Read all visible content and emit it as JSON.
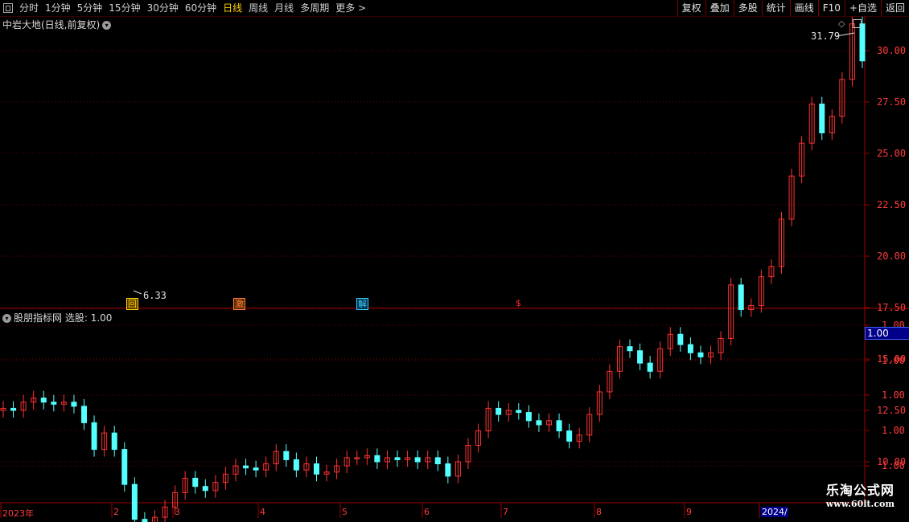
{
  "toolbar": {
    "periods": [
      "分时",
      "1分钟",
      "5分钟",
      "15分钟",
      "30分钟",
      "60分钟",
      "日线",
      "周线",
      "月线",
      "多周期",
      "更多 >"
    ],
    "active_period": "日线",
    "right_buttons": [
      "复权",
      "叠加",
      "多股",
      "统计",
      "画线",
      "F10",
      "+自选",
      "返回"
    ]
  },
  "main_panel": {
    "title": "中岩大地(日线,前复权)",
    "dropdown_icon": "chevron-down-icon",
    "max_label": "31.79",
    "min_label": "6.33",
    "price_axis": [
      "30.00",
      "27.50",
      "25.00",
      "22.50",
      "20.00",
      "17.50",
      "15.00",
      "12.50",
      "10.00"
    ],
    "markers": [
      {
        "text": "回",
        "color": "#ffd400",
        "bg": "#5a3a00"
      },
      {
        "text": "激",
        "color": "#ff8040",
        "bg": "#5a2a00"
      },
      {
        "text": "解",
        "color": "#40d0ff",
        "bg": "#00304a"
      },
      {
        "text": "$",
        "color": "#ff3030",
        "bg": "transparent"
      }
    ]
  },
  "indicator_panel": {
    "title": "股朋指标网",
    "value_label": "选股: 1.00",
    "axis": [
      "1.00",
      "1.00",
      "1.00",
      "1.00",
      "1.00"
    ],
    "current_value": "1.00"
  },
  "date_axis": [
    "2023年",
    "2",
    "3",
    "4",
    "5",
    "6",
    "7",
    "8",
    "9",
    "2024/"
  ],
  "watermark": {
    "line1": "乐淘公式网",
    "line2": "www.60lt.com"
  },
  "colors": {
    "up": "#ff3232",
    "down": "#54ffff",
    "grid": "#7a0000",
    "axis_text": "#ff3b3b"
  },
  "chart_data": {
    "type": "candlestick",
    "title": "中岩大地(日线,前复权)",
    "y_axis_ticks": [
      10.0,
      12.5,
      15.0,
      17.5,
      20.0,
      22.5,
      25.0,
      27.5,
      30.0
    ],
    "x_month_labels": [
      "2023年",
      "2",
      "3",
      "4",
      "5",
      "6",
      "7",
      "8",
      "9",
      "2024/"
    ],
    "annotated_high": 31.79,
    "annotated_low": 6.33,
    "series": [
      {
        "name": "close",
        "values": [
          12.6,
          12.5,
          12.9,
          13.1,
          12.9,
          12.8,
          12.9,
          12.7,
          11.9,
          10.6,
          11.4,
          10.6,
          8.9,
          7.2,
          6.4,
          7.3,
          7.8,
          8.5,
          9.2,
          8.8,
          8.6,
          9.0,
          9.4,
          9.8,
          9.7,
          9.6,
          9.9,
          10.5,
          10.1,
          9.6,
          9.9,
          9.4,
          9.5,
          9.8,
          10.2,
          10.2,
          10.3,
          10.0,
          10.2,
          10.1,
          10.2,
          10.0,
          10.2,
          9.9,
          9.3,
          10.0,
          10.8,
          11.5,
          12.6,
          12.3,
          12.5,
          12.4,
          12.0,
          11.8,
          12.0,
          11.5,
          11.0,
          11.3,
          12.3,
          13.4,
          14.4,
          15.6,
          15.4,
          14.8,
          14.4,
          15.5,
          16.2,
          15.7,
          15.3,
          15.1,
          15.3,
          16.0,
          18.6,
          17.4,
          17.6,
          19.0,
          19.5,
          21.8,
          23.9,
          25.5,
          27.4,
          26.0,
          26.8,
          28.6,
          31.3,
          29.5
        ]
      }
    ]
  }
}
